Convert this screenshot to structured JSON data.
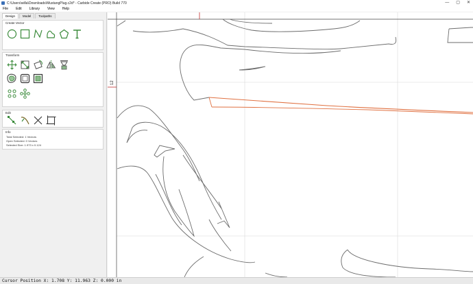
{
  "window": {
    "title": "C:\\Users\\willa\\Downloads\\MustangPlug.c2d* - Carbide Create (PRO) Build 770",
    "minimize_glyph": "—",
    "maximize_glyph": "▢",
    "close_glyph": "✕"
  },
  "menu": [
    "File",
    "Edit",
    "Library",
    "View",
    "Help"
  ],
  "tabs": [
    "Design",
    "Model",
    "Toolpaths"
  ],
  "active_tab": "Design",
  "panel": {
    "create_vector": {
      "title": "Create Vector",
      "tools": [
        "circle-tool-icon",
        "rectangle-tool-icon",
        "polyline-tool-icon",
        "curve-tool-icon",
        "polygon-tool-icon",
        "text-tool-icon"
      ]
    },
    "transform": {
      "title": "Transform",
      "tools": [
        "move-icon",
        "scale-icon",
        "rotate-icon",
        "mirror-icon",
        "align-icon",
        "offset-icon",
        "group-icon",
        "ungroup-icon",
        "array-icon",
        "circular-array-icon"
      ]
    },
    "edit": {
      "title": "Edit",
      "tools": [
        "node-edit-icon",
        "trim-icon",
        "cut-icon",
        "boolean-icon"
      ]
    },
    "info": {
      "title": "Info",
      "total_selected": "Total Selected:  1 Vectors",
      "open_selected": "Open Selected:  0 Vectors",
      "selected_size": "Selected Size:  1.973 x 0.124"
    }
  },
  "canvas": {
    "ruler_label": "12",
    "accent_color": "#e07040",
    "vector_color": "#6b6b6b",
    "grid_color": "#d8d8d8"
  },
  "status": {
    "text": "Cursor Position X: 1.708 Y: 11.963 Z: 0.000 in"
  }
}
